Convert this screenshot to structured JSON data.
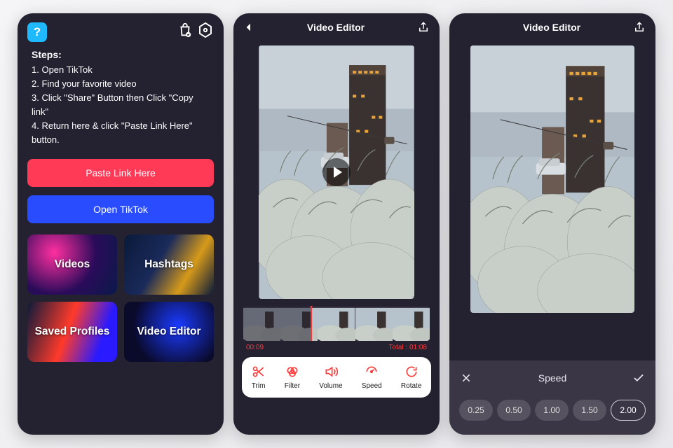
{
  "screen1": {
    "steps_heading": "Steps:",
    "steps": [
      "Open TikTok",
      "Find your favorite video",
      "Click \"Share\" Button then Click \"Copy link\"",
      "Return here & click \"Paste Link Here\" button."
    ],
    "paste_btn": "Paste Link Here",
    "open_btn": "Open TikTok",
    "tiles": [
      "Videos",
      "Hashtags",
      "Saved Profiles",
      "Video Editor"
    ]
  },
  "editor": {
    "title": "Video Editor",
    "current_time": "00:09",
    "total_time": "Total : 01:08",
    "tools": [
      "Trim",
      "Filter",
      "Volume",
      "Speed",
      "Rotate"
    ]
  },
  "speed_panel": {
    "title": "Speed",
    "options": [
      "0.25",
      "0.50",
      "1.00",
      "1.50",
      "2.00"
    ],
    "selected": "2.00"
  }
}
